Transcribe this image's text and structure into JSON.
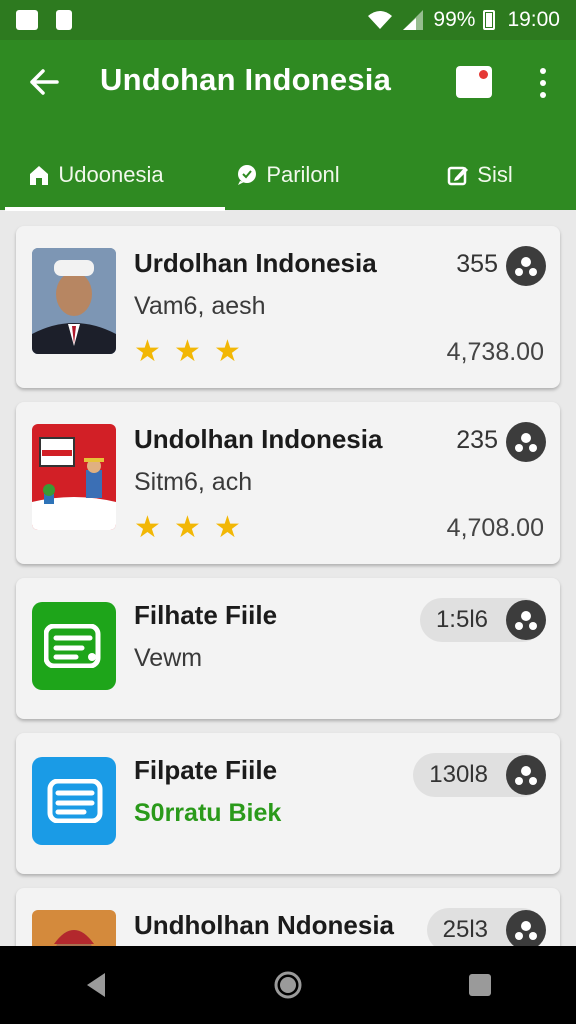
{
  "status_bar": {
    "battery": "99%",
    "time": "19:00"
  },
  "app_bar": {
    "title": "Undohan Indonesia",
    "icons": [
      "back-arrow-icon",
      "notification-icon",
      "more-vert-icon"
    ]
  },
  "tabs": [
    {
      "label": "Udoonesia",
      "icon": "home-icon",
      "selected": true
    },
    {
      "label": "Parilonl",
      "icon": "chat-icon",
      "selected": false
    },
    {
      "label": "Sisl",
      "icon": "edit-icon",
      "selected": false
    }
  ],
  "items": [
    {
      "name": "Urdolhan Indonesia",
      "subtitle": "Vam6, aesh",
      "count": "355",
      "price": "4,738.00",
      "rating": 3
    },
    {
      "name": "Undolhan Indonesia",
      "subtitle": "Sitm6, ach",
      "count": "235",
      "price": "4,708.00",
      "rating": 3
    },
    {
      "name": "Filhate Fiile",
      "subtitle": "Vewm",
      "count": "1:5l6",
      "color": "#1ea51a"
    },
    {
      "name": "Filpate Fiile",
      "subtitle": "S0rratu Biek",
      "count": "130l8",
      "color": "#1a9be6"
    },
    {
      "name": "Undholhan Ndonesia",
      "count": "25l3"
    }
  ],
  "colors": {
    "primary": "#2f8a22",
    "status": "#2d7a1f",
    "star": "#f2b705"
  }
}
